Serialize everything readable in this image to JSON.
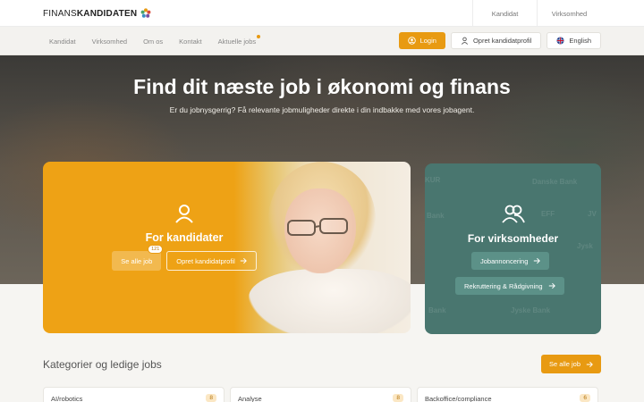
{
  "logo": {
    "part1": "FINANS",
    "part2": "KANDIDATEN"
  },
  "top_links": [
    "Kandidat",
    "Virksomhed"
  ],
  "nav": {
    "items": [
      "Kandidat",
      "Virksomhed",
      "Om os",
      "Kontakt",
      "Aktuelle jobs"
    ],
    "login": "Login",
    "create_profile": "Opret kandidatprofil",
    "language": "English"
  },
  "hero": {
    "title": "Find dit næste job i økonomi og finans",
    "subtitle": "Er du jobnysgerrig? Få relevante jobmuligheder direkte i din indbakke med vores jobagent."
  },
  "candidates": {
    "title": "For kandidater",
    "see_all": "Se alle job",
    "badge": "121",
    "create_profile": "Opret kandidatprofil"
  },
  "companies": {
    "title": "For virksomheder",
    "job_ads": "Jobannoncering",
    "recruitment": "Rekruttering & Rådgivning"
  },
  "categories": {
    "title": "Kategorier og ledige jobs",
    "see_all": "Se alle job",
    "items": [
      {
        "name": "AI/robotics",
        "count": "8"
      },
      {
        "name": "Analyse",
        "count": "8"
      },
      {
        "name": "Backoffice/compliance",
        "count": "6"
      }
    ]
  },
  "colors": {
    "accent": "#e89a12",
    "teal": "#49766f"
  }
}
